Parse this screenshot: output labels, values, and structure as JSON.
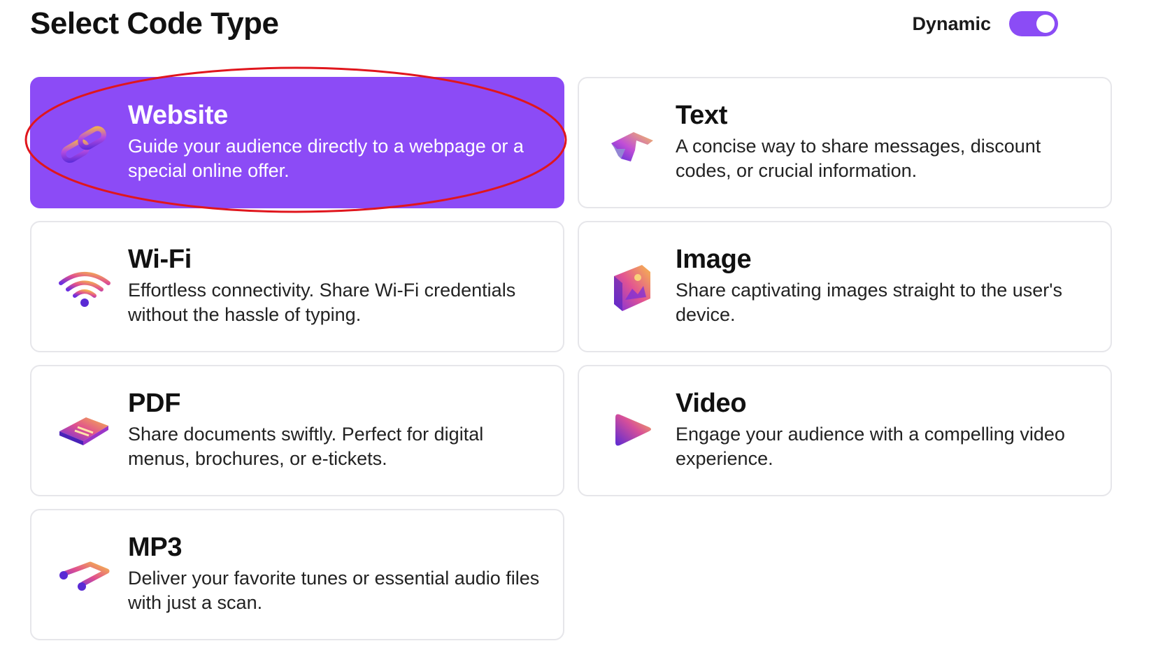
{
  "header": {
    "title": "Select Code Type",
    "dynamic_label": "Dynamic",
    "dynamic_enabled": true
  },
  "colors": {
    "accent": "#8c4bf6",
    "highlight_annotation": "#e0161d"
  },
  "code_types": [
    {
      "title": "Website",
      "description": "Guide your audience directly to a webpage or a special online offer.",
      "icon": "link-chain-icon",
      "selected": true
    },
    {
      "title": "Text",
      "description": "A concise way to share messages, discount codes, or crucial information.",
      "icon": "text-t-icon",
      "selected": false
    },
    {
      "title": "Wi-Fi",
      "description": "Effortless connectivity. Share Wi-Fi credentials without the hassle of typing.",
      "icon": "wifi-icon",
      "selected": false
    },
    {
      "title": "Image",
      "description": "Share captivating images straight to the user's device.",
      "icon": "image-icon",
      "selected": false
    },
    {
      "title": "PDF",
      "description": "Share documents swiftly. Perfect for digital menus, brochures, or e-tickets.",
      "icon": "document-icon",
      "selected": false
    },
    {
      "title": "Video",
      "description": "Engage your audience with a compelling video experience.",
      "icon": "play-icon",
      "selected": false
    },
    {
      "title": "MP3",
      "description": "Deliver your favorite tunes or essential audio files with just a scan.",
      "icon": "music-note-icon",
      "selected": false
    }
  ]
}
